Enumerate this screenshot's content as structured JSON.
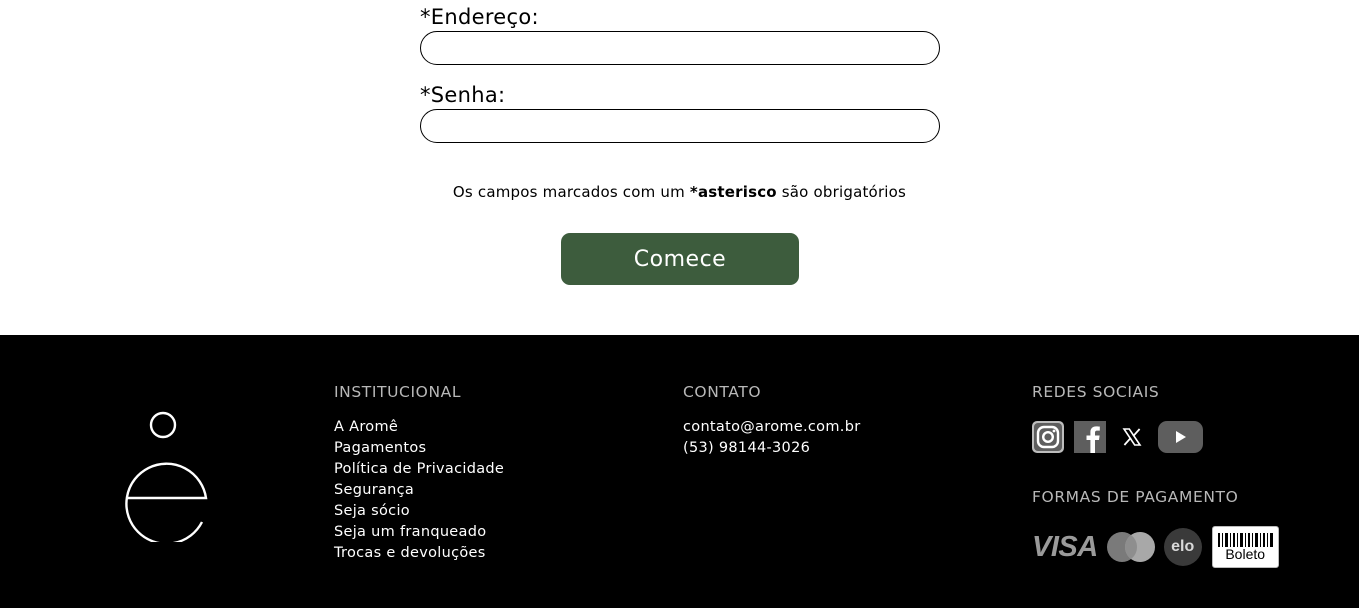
{
  "form": {
    "address_label": "*Endereço:",
    "address_value": "",
    "password_label": "*Senha:",
    "password_value": "",
    "note_prefix": "Os campos marcados com um ",
    "note_bold": "*asterisco",
    "note_suffix": " são obrigatórios",
    "submit_label": "Comece"
  },
  "footer": {
    "logo_icon": "arome-e-logo",
    "institutional": {
      "title": "INSTITUCIONAL",
      "links": [
        "A Aromê",
        "Pagamentos",
        "Política de Privacidade",
        "Segurança",
        "Seja sócio",
        "Seja um franqueado",
        "Trocas e devoluções"
      ]
    },
    "contact": {
      "title": "CONTATO",
      "email": "contato@arome.com.br",
      "phone": "(53) 98144-3026"
    },
    "social": {
      "title": "REDES SOCIAIS",
      "icons": [
        "instagram-icon",
        "facebook-icon",
        "x-icon",
        "youtube-icon"
      ]
    },
    "payment": {
      "title": "FORMAS DE PAGAMENTO",
      "visa_text": "VISA",
      "elo_text": "elo",
      "boleto_text": "Boleto",
      "icons": [
        "visa-icon",
        "mastercard-icon",
        "elo-icon",
        "boleto-icon"
      ]
    }
  },
  "colors": {
    "button_bg": "#3d5c3d",
    "footer_bg": "#000000",
    "footer_title": "#b8b8b8"
  }
}
